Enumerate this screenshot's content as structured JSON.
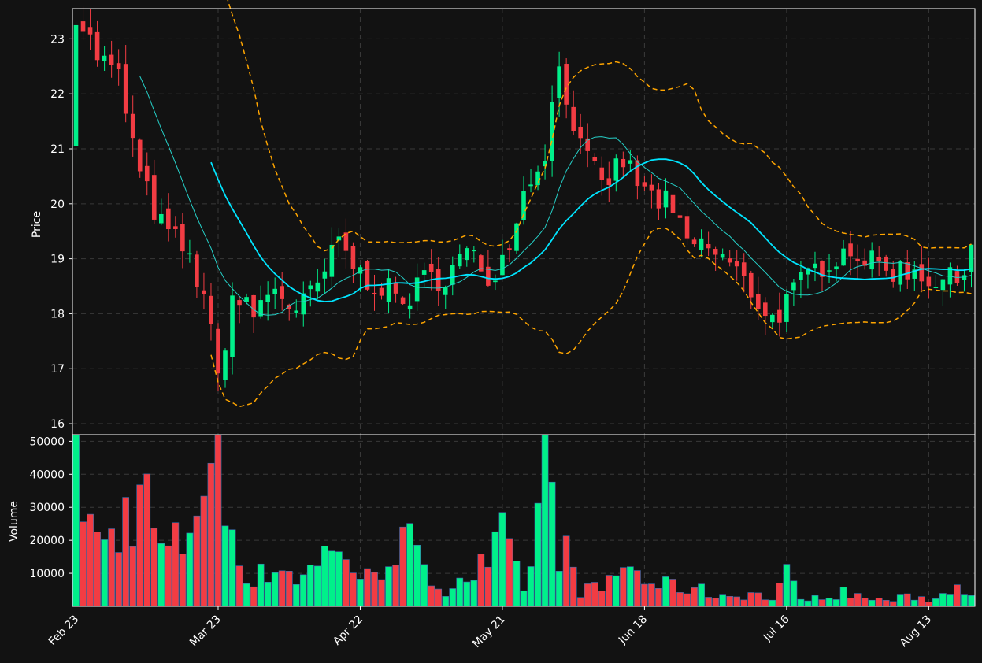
{
  "colors": {
    "background": "#121212",
    "up": "#00f08a",
    "down": "#f23c43",
    "grid": "#3a3a3a",
    "axis": "#ffffff",
    "sma_long": "#00e5ff",
    "sma_short": "#26d0c8",
    "band": "#ffa500"
  },
  "chart_data": {
    "type": "candlestick",
    "panels": [
      {
        "name": "price",
        "ylabel": "Price",
        "ylim": [
          15.8,
          23.55
        ],
        "yticks": [
          16,
          17,
          18,
          19,
          20,
          21,
          22,
          23
        ]
      },
      {
        "name": "volume",
        "ylabel": "Volume",
        "ylim": [
          0,
          52000
        ],
        "yticks": [
          10000,
          20000,
          30000,
          40000,
          50000
        ]
      }
    ],
    "xticks": [
      {
        "label": "Feb 23",
        "index": 0
      },
      {
        "label": "Mar 23",
        "index": 20
      },
      {
        "label": "Apr 22",
        "index": 40
      },
      {
        "label": "May 21",
        "index": 60
      },
      {
        "label": "Jun 18",
        "index": 80
      },
      {
        "label": "Jul 16",
        "index": 100
      },
      {
        "label": "Aug 13",
        "index": 120
      }
    ],
    "grid": true,
    "anchors": [
      [
        0,
        23.5,
        45000
      ],
      [
        3,
        22.7,
        18000
      ],
      [
        6,
        22.3,
        22000
      ],
      [
        9,
        20.5,
        38000
      ],
      [
        12,
        19.6,
        16000
      ],
      [
        15,
        19.2,
        19000
      ],
      [
        18,
        18.4,
        42000
      ],
      [
        20,
        16.8,
        40000
      ],
      [
        22,
        18.3,
        23000
      ],
      [
        25,
        18.0,
        7000
      ],
      [
        28,
        18.5,
        13000
      ],
      [
        31,
        18.0,
        9000
      ],
      [
        34,
        18.5,
        12000
      ],
      [
        37,
        19.3,
        22000
      ],
      [
        40,
        18.7,
        6000
      ],
      [
        43,
        18.5,
        14000
      ],
      [
        46,
        18.2,
        22000
      ],
      [
        49,
        18.6,
        9000
      ],
      [
        52,
        18.7,
        6000
      ],
      [
        55,
        19.1,
        10000
      ],
      [
        58,
        18.7,
        12000
      ],
      [
        60,
        19.0,
        20000
      ],
      [
        63,
        20.2,
        4000
      ],
      [
        66,
        21.0,
        42000
      ],
      [
        68,
        22.5,
        20000
      ],
      [
        71,
        21.0,
        5000
      ],
      [
        74,
        20.3,
        5000
      ],
      [
        77,
        20.8,
        13000
      ],
      [
        80,
        20.2,
        8000
      ],
      [
        83,
        20.0,
        6000
      ],
      [
        86,
        19.3,
        6000
      ],
      [
        89,
        19.2,
        4000
      ],
      [
        92,
        18.9,
        3000
      ],
      [
        95,
        18.4,
        4000
      ],
      [
        98,
        17.9,
        2000
      ],
      [
        100,
        18.2,
        9000
      ],
      [
        103,
        18.7,
        1500
      ],
      [
        106,
        19.0,
        4000
      ],
      [
        109,
        19.2,
        4000
      ],
      [
        112,
        18.9,
        2000
      ],
      [
        115,
        18.8,
        2000
      ],
      [
        118,
        18.8,
        3000
      ],
      [
        121,
        18.6,
        2000
      ],
      [
        124,
        18.6,
        8000
      ],
      [
        126,
        19.3,
        5500
      ]
    ]
  }
}
